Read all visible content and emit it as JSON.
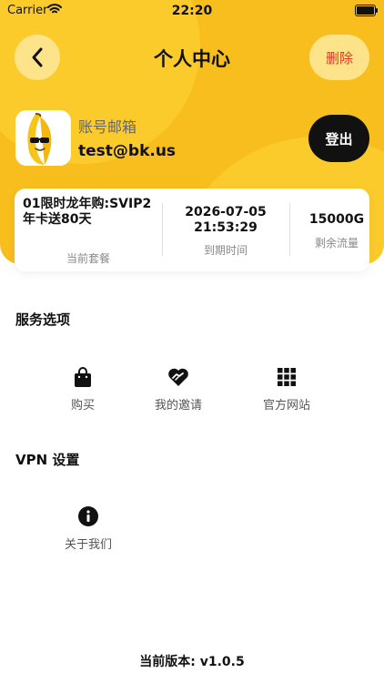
{
  "status_bar": {
    "carrier": "Carrier",
    "time": "22:20"
  },
  "header": {
    "title": "个人中心",
    "delete_label": "删除"
  },
  "account": {
    "email_label": "账号邮箱",
    "email": "test@bk.us",
    "logout_label": "登出"
  },
  "subscription": {
    "plan_value": "01限时龙年购:SVIP2年卡送80天",
    "plan_label": "当前套餐",
    "expiry_date": "2026-07-05",
    "expiry_time": "21:53:29",
    "expiry_label": "到期时间",
    "traffic_value": "15000G",
    "traffic_label": "剩余流量"
  },
  "services": {
    "title": "服务选项",
    "items": [
      {
        "label": "购买",
        "icon": "shopping-bag-icon"
      },
      {
        "label": "我的邀请",
        "icon": "handshake-heart-icon"
      },
      {
        "label": "官方网站",
        "icon": "grid-icon"
      }
    ]
  },
  "vpn_settings": {
    "title": "VPN 设置",
    "items": [
      {
        "label": "关于我们",
        "icon": "info-icon"
      }
    ]
  },
  "footer": {
    "version": "当前版本: v1.0.5"
  },
  "colors": {
    "brand_yellow": "#f8be1d",
    "delete_red": "#e8351f",
    "dark": "#111111"
  }
}
